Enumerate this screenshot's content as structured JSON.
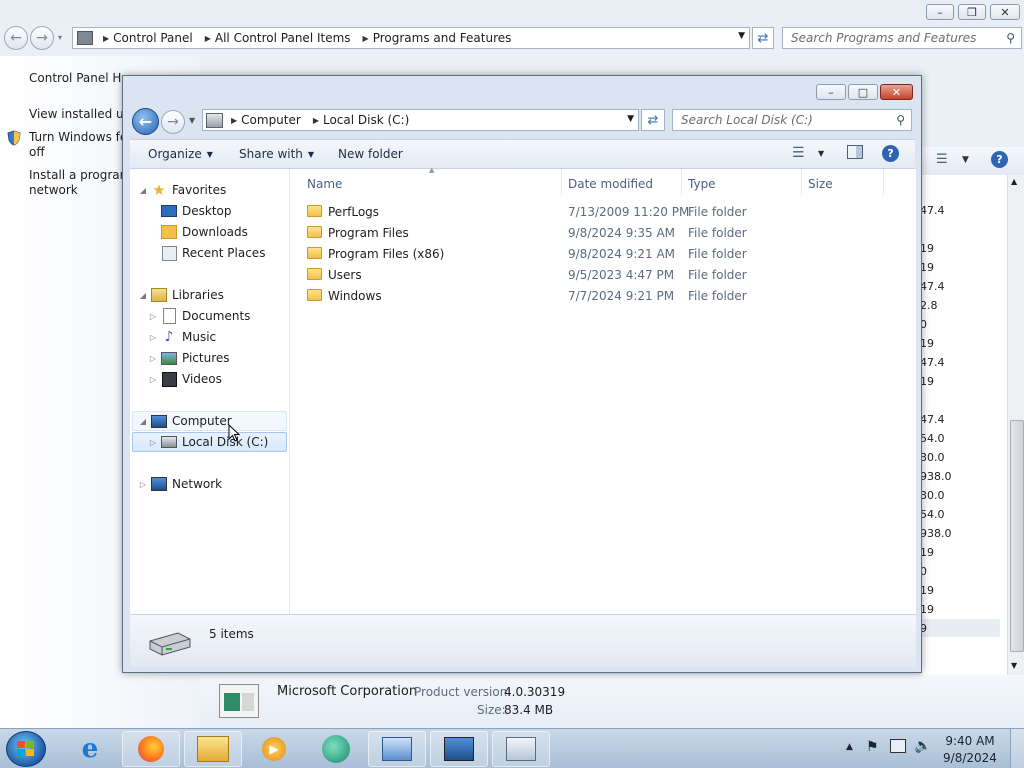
{
  "background_window": {
    "breadcrumbs": [
      "Control Panel",
      "All Control Panel Items",
      "Programs and Features"
    ],
    "search_placeholder": "Search Programs and Features",
    "tasks": {
      "home": "Control Panel Home",
      "view_updates": "View installed updates",
      "windows_features_1": "Turn Windows features on or",
      "windows_features_2": "off",
      "install_network_1": "Install a program from the",
      "install_network_2": "network"
    },
    "column_values": [
      "47.4",
      "19",
      "19",
      "47.4",
      "2.8",
      "0",
      "19",
      "47.4",
      "19",
      "47.4",
      "54.0",
      "30.0",
      "938.0",
      "30.0",
      "54.0",
      "938.0",
      "19",
      "0",
      "19",
      "19",
      "9"
    ],
    "details": {
      "publisher": "Microsoft Corporation",
      "product_version_label": "Product version:",
      "product_version": "4.0.30319",
      "size_label": "Size:",
      "size": "83.4 MB"
    }
  },
  "explorer": {
    "breadcrumbs": [
      "Computer",
      "Local Disk (C:)"
    ],
    "search_placeholder": "Search Local Disk (C:)",
    "toolbar": {
      "organize": "Organize",
      "share_with": "Share with",
      "new_folder": "New folder"
    },
    "nav": {
      "favorites": "Favorites",
      "desktop": "Desktop",
      "downloads": "Downloads",
      "recent_places": "Recent Places",
      "libraries": "Libraries",
      "documents": "Documents",
      "music": "Music",
      "pictures": "Pictures",
      "videos": "Videos",
      "computer": "Computer",
      "local_disk": "Local Disk (C:)",
      "network": "Network"
    },
    "columns": {
      "name": "Name",
      "date_modified": "Date modified",
      "type": "Type",
      "size": "Size"
    },
    "files": [
      {
        "name": "PerfLogs",
        "date": "7/13/2009 11:20 PM",
        "type": "File folder"
      },
      {
        "name": "Program Files",
        "date": "9/8/2024 9:35 AM",
        "type": "File folder"
      },
      {
        "name": "Program Files (x86)",
        "date": "9/8/2024 9:21 AM",
        "type": "File folder"
      },
      {
        "name": "Users",
        "date": "9/5/2023 4:47 PM",
        "type": "File folder"
      },
      {
        "name": "Windows",
        "date": "7/7/2024 9:21 PM",
        "type": "File folder"
      }
    ],
    "status": "5 items"
  },
  "taskbar": {
    "time": "9:40 AM",
    "date": "9/8/2024"
  },
  "colors": {
    "accent": "#3a6fb7",
    "close_red": "#c7412f"
  }
}
